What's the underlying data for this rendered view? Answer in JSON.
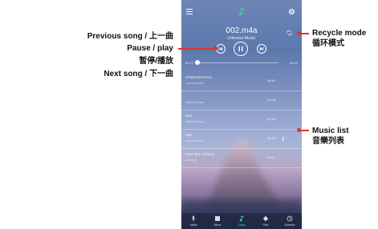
{
  "now_playing": {
    "title": "002.m4a",
    "artist": "Unknow Music",
    "elapsed": "00:12",
    "duration": "44:23",
    "progress": 0.02
  },
  "tracks": [
    {
      "title": "075521537619...",
      "subtitle": "Unknow Music",
      "time": "08:49"
    },
    {
      "title": "",
      "subtitle": "Unknow Music",
      "time": "01:08"
    },
    {
      "title": "003",
      "subtitle": "Unknow Music",
      "time": "01:14"
    },
    {
      "title": "002...",
      "subtitle": "Unknow Music",
      "time": "44:23"
    },
    {
      "title": "Over the Horizon",
      "subtitle": "Samsung",
      "time": "03:11"
    }
  ],
  "bottom_nav": [
    {
      "label": "Artists",
      "icon": "mic-icon"
    },
    {
      "label": "Album",
      "icon": "album-icon"
    },
    {
      "label": "Songs",
      "icon": "music-note-icon",
      "active": true
    },
    {
      "label": "Files",
      "icon": "folder-icon"
    },
    {
      "label": "Schedule",
      "icon": "clock-icon"
    }
  ],
  "callouts": {
    "previous_song": "Previous song / 上一曲",
    "pause_play": "Pause / play",
    "pause_play_cn": "暂停/播放",
    "next_song": "Next song / 下一曲",
    "recycle_mode": "Recycle mode",
    "recycle_mode_cn": "循环模式",
    "music_list": "Music list",
    "music_list_cn": "音樂列表"
  },
  "colors": {
    "annotation_red": "#d8362b",
    "accent_green": "#3fd1a4"
  }
}
